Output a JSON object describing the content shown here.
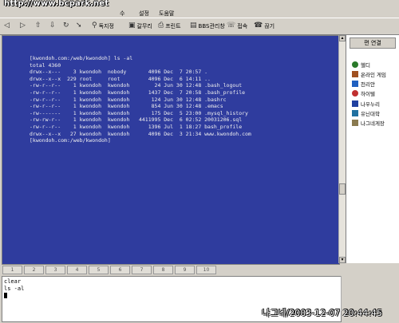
{
  "window": {
    "watermark": "http://www.bcpark.net"
  },
  "menu": [
    "수",
    "설정",
    "도움말"
  ],
  "toolbar": {
    "buttons": [
      {
        "label": "",
        "icon": "back-icon"
      },
      {
        "label": "",
        "icon": "forward-icon"
      },
      {
        "label": "",
        "icon": "upload-icon"
      },
      {
        "label": "",
        "icon": "download-icon"
      },
      {
        "label": "",
        "icon": "refresh-icon"
      },
      {
        "label": "독지정",
        "icon": "magnify-icon"
      },
      {
        "label": "갈무리",
        "icon": "save-icon"
      },
      {
        "label": "프린트",
        "icon": "printer-icon"
      },
      {
        "label": "BBS관리창",
        "icon": "window-icon"
      },
      {
        "label": "접속",
        "icon": "connect-icon"
      },
      {
        "label": "끊기",
        "icon": "disconnect-icon"
      }
    ]
  },
  "terminal": {
    "lines": [
      "[kwondoh.com:/web/kwondoh] ls -al",
      "total 4360",
      "drwx--x---    3 kwondoh  nobody       4096 Dec  7 20:57 .",
      "drwx--x--x  229 root     root         4096 Dec  6 14:11 ..",
      "-rw-r--r--    1 kwondoh  kwondoh        24 Jun 30 12:48 .bash_logout",
      "-rw-r--r--    1 kwondoh  kwondoh      1437 Dec  7 20:58 .bash_profile",
      "-rw-r--r--    1 kwondoh  kwondoh       124 Jun 30 12:48 .bashrc",
      "-rw-r--r--    1 kwondoh  kwondoh       854 Jun 30 12:48 .emacs",
      "-rw-------    1 kwondoh  kwondoh       175 Dec  5 23:00 .mysql_history",
      "-rw-rw-r--    1 kwondoh  kwondoh   4411995 Dec  6 02:52 20031206.sql",
      "-rw-r--r--    1 kwondoh  kwondoh      1396 Jul  1 18:27 bash_profile",
      "drwx--x--x   27 kwondoh  kwondoh      4096 Dec  3 21:34 www.kwondoh.com",
      "[kwondoh.com:/web/kwondoh]"
    ],
    "colors": {
      "background": "#2f3c9e",
      "text": "#f0f0f0"
    }
  },
  "sidebar": {
    "header": "편 연결",
    "items": [
      {
        "label": "헬디",
        "icon": "gear-icon",
        "color": "#2a7a2a"
      },
      {
        "label": "온라인 게임",
        "icon": "game-icon",
        "color": "#a05020"
      },
      {
        "label": "천리안",
        "icon": "chollian-icon",
        "color": "#2060c0"
      },
      {
        "label": "하이텔",
        "icon": "hitel-icon",
        "color": "#c03030"
      },
      {
        "label": "나우누리",
        "icon": "nownuri-icon",
        "color": "#2040a0"
      },
      {
        "label": "유닌대학",
        "icon": "university-icon",
        "color": "#2070a0"
      },
      {
        "label": "나그네게장",
        "icon": "document-icon",
        "color": "#8a7a50"
      }
    ]
  },
  "tabs": [
    "1",
    "2",
    "3",
    "4",
    "5",
    "6",
    "7",
    "8",
    "9",
    "10"
  ],
  "input": {
    "lines": [
      "clear",
      "ls -al"
    ]
  },
  "watermark_bottom": "나그네/2003-12-07 20:44:45"
}
